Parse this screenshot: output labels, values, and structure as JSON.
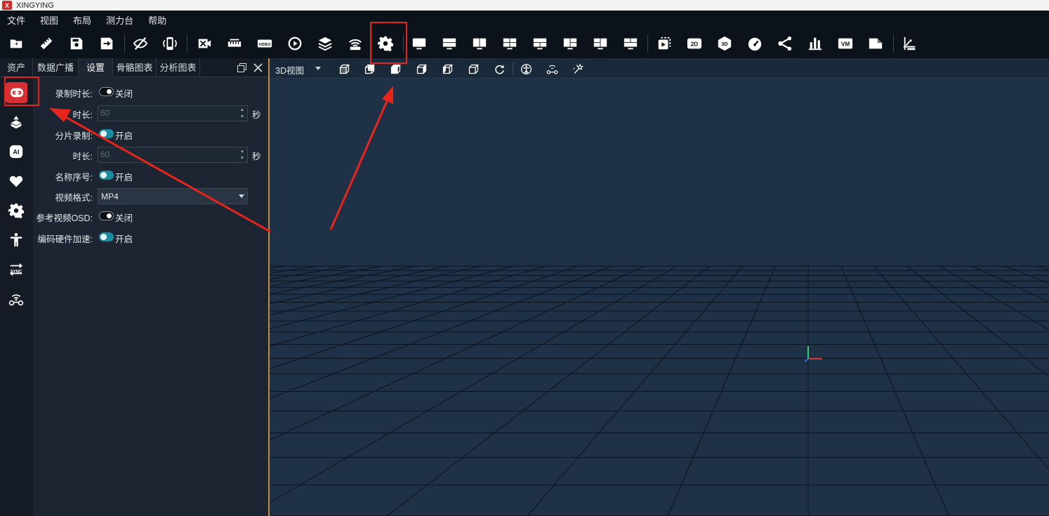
{
  "app": {
    "title": "XINGYING",
    "logo_text": "X"
  },
  "menu": {
    "file": "文件",
    "view": "视图",
    "layout": "布局",
    "bench": "测力台",
    "help": "帮助"
  },
  "toolbar": {
    "icons": [
      "open-project-icon",
      "ruler-icon",
      "save-icon",
      "export-icon",
      "hide-icon",
      "device-sync-icon",
      "camera-calibrate-icon",
      "ruler-calibrate-icon",
      "video-icon",
      "replay-icon",
      "layers-icon",
      "wireless-icon",
      "settings-gear-icon",
      "view-single-icon",
      "view-split-h-icon",
      "view-split-v-icon",
      "view-quad-icon",
      "view-layout-5-icon",
      "view-layout-6-icon",
      "view-layout-7-icon",
      "view-layout-8-icon",
      "playback-icon",
      "2d-icon",
      "3d-icon",
      "gauge-icon",
      "skeleton-link-icon",
      "bar-chart-icon",
      "vm-icon",
      "document-icon",
      "force-plate-icon"
    ],
    "label_2d": "2D",
    "label_3d": "3D",
    "label_vm": "VM",
    "label_video": "VIDEO"
  },
  "tabs": [
    {
      "label": "资产",
      "active": false
    },
    {
      "label": "数据广播",
      "active": false
    },
    {
      "label": "设置",
      "active": true
    },
    {
      "label": "骨骼图表",
      "active": false
    },
    {
      "label": "分析图表",
      "active": false
    }
  ],
  "sidebar_icons": [
    "recording-icon",
    "rigid-body-icon",
    "ai-icon",
    "heart-icon",
    "settings-icon",
    "human-body-icon",
    "sync-icon",
    "wireless-sensor-icon"
  ],
  "sidebar_text": {
    "ai": "AI",
    "sync": "SYNC"
  },
  "settings": {
    "record_duration": {
      "label": "录制时长:",
      "state": "关闭"
    },
    "duration1": {
      "label": "时长:",
      "value": "60",
      "unit": "秒"
    },
    "segment_record": {
      "label": "分片录制:",
      "state": "开启"
    },
    "duration2": {
      "label": "时长:",
      "value": "60",
      "unit": "秒"
    },
    "name_index": {
      "label": "名称序号:",
      "state": "开启"
    },
    "video_format": {
      "label": "视频格式:",
      "value": "MP4"
    },
    "ref_video_osd": {
      "label": "参考视频OSD:",
      "state": "关闭"
    },
    "hw_accel": {
      "label": "编码硬件加速:",
      "state": "开启"
    }
  },
  "viewport": {
    "view_select": "3D视图",
    "buttons": [
      "view-front-icon",
      "view-back-icon",
      "view-top-icon",
      "view-bottom-icon",
      "view-left-icon",
      "view-right-icon",
      "reset-view-icon",
      "show-skeleton-icon",
      "show-marker-icon",
      "show-trail-icon"
    ]
  },
  "colors": {
    "accent_red": "#e8241b",
    "toggle_on": "#1a8ca2",
    "viewport_bg": "#1f3146",
    "panel_bg": "#1c2531"
  }
}
